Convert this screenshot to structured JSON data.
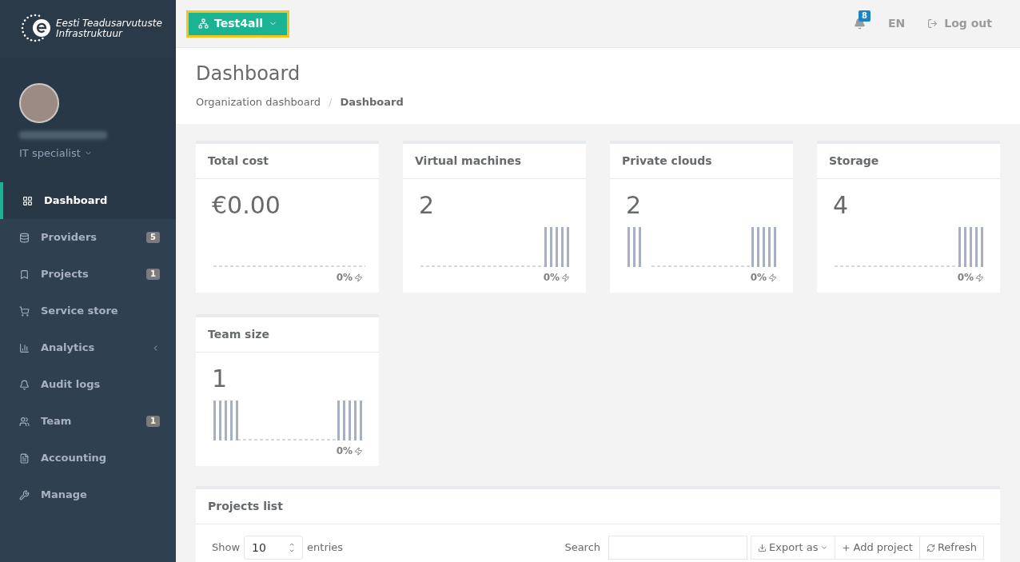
{
  "brand": {
    "line1": "Eesti Teadusarvutuste",
    "line2": "Infrastruktuur"
  },
  "profile": {
    "role": "IT specialist"
  },
  "sidebar": {
    "items": [
      {
        "label": "Dashboard",
        "kind": "grid",
        "selected": true
      },
      {
        "label": "Providers",
        "kind": "database",
        "badge": "5",
        "selected": false
      },
      {
        "label": "Projects",
        "kind": "bookmark",
        "badge": "1",
        "selected": false
      },
      {
        "label": "Service store",
        "kind": "cart",
        "selected": false
      },
      {
        "label": "Analytics",
        "kind": "chart",
        "expandable": true,
        "selected": false
      },
      {
        "label": "Audit logs",
        "kind": "bell",
        "selected": false
      },
      {
        "label": "Team",
        "kind": "users",
        "badge": "1",
        "selected": false
      },
      {
        "label": "Accounting",
        "kind": "file",
        "selected": false
      },
      {
        "label": "Manage",
        "kind": "wrench",
        "selected": false
      }
    ]
  },
  "topbar": {
    "organization": "Test4all",
    "notifications": "8",
    "language": "EN",
    "logout": "Log out"
  },
  "header": {
    "title": "Dashboard",
    "separator": "/",
    "breadcrumbs": [
      {
        "label": "Organization dashboard",
        "selected": false
      },
      {
        "label": "Dashboard",
        "selected": true
      }
    ]
  },
  "cards": [
    {
      "title": "Total cost",
      "value": "€0.00",
      "kind": "flat",
      "change": "0%"
    },
    {
      "title": "Virtual machines",
      "value": "2",
      "kind": "end",
      "change": "0%"
    },
    {
      "title": "Private clouds",
      "value": "2",
      "kind": "both",
      "change": "0%"
    },
    {
      "title": "Storage",
      "value": "4",
      "kind": "end",
      "change": "0%"
    },
    {
      "title": "Team size",
      "value": "1",
      "kind": "both",
      "change": "0%"
    }
  ],
  "projects_list": {
    "title": "Projects list",
    "show_label": "Show",
    "page_size": "10",
    "entries_label": "entries",
    "search_label": "Search",
    "buttons": [
      {
        "label": "Export as",
        "kind": "download",
        "dropdown": true
      },
      {
        "label": "Add project",
        "kind": "plus",
        "dropdown": false
      },
      {
        "label": "Refresh",
        "kind": "refresh",
        "dropdown": false
      }
    ]
  }
}
